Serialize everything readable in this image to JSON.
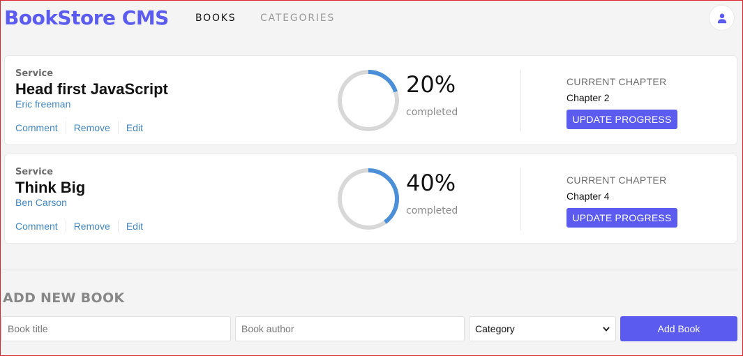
{
  "app": {
    "title": "BookStore CMS"
  },
  "nav": [
    {
      "label": "BOOKS",
      "active": true
    },
    {
      "label": "CATEGORIES",
      "active": false
    }
  ],
  "header": {
    "user_icon": "user-icon"
  },
  "colors": {
    "accent": "#5b5bf0",
    "link": "#4386bf",
    "progress": "#4a8fd8",
    "track": "#d8d8d8"
  },
  "books": [
    {
      "genre": "Service",
      "title": "Head first JavaScript",
      "author": "Eric freeman",
      "actions": [
        "Comment",
        "Remove",
        "Edit"
      ],
      "progress": 20,
      "progress_label": "20%",
      "completed_label": "completed",
      "chapter_label": "CURRENT CHAPTER",
      "chapter": "Chapter 2",
      "update_label": "UPDATE PROGRESS"
    },
    {
      "genre": "Service",
      "title": "Think Big",
      "author": "Ben Carson",
      "actions": [
        "Comment",
        "Remove",
        "Edit"
      ],
      "progress": 40,
      "progress_label": "40%",
      "completed_label": "completed",
      "chapter_label": "CURRENT CHAPTER",
      "chapter": "Chapter 4",
      "update_label": "UPDATE PROGRESS"
    }
  ],
  "add_book": {
    "heading": "ADD NEW BOOK",
    "title_placeholder": "Book title",
    "author_placeholder": "Book author",
    "category_value": "Category",
    "submit_label": "Add Book"
  }
}
